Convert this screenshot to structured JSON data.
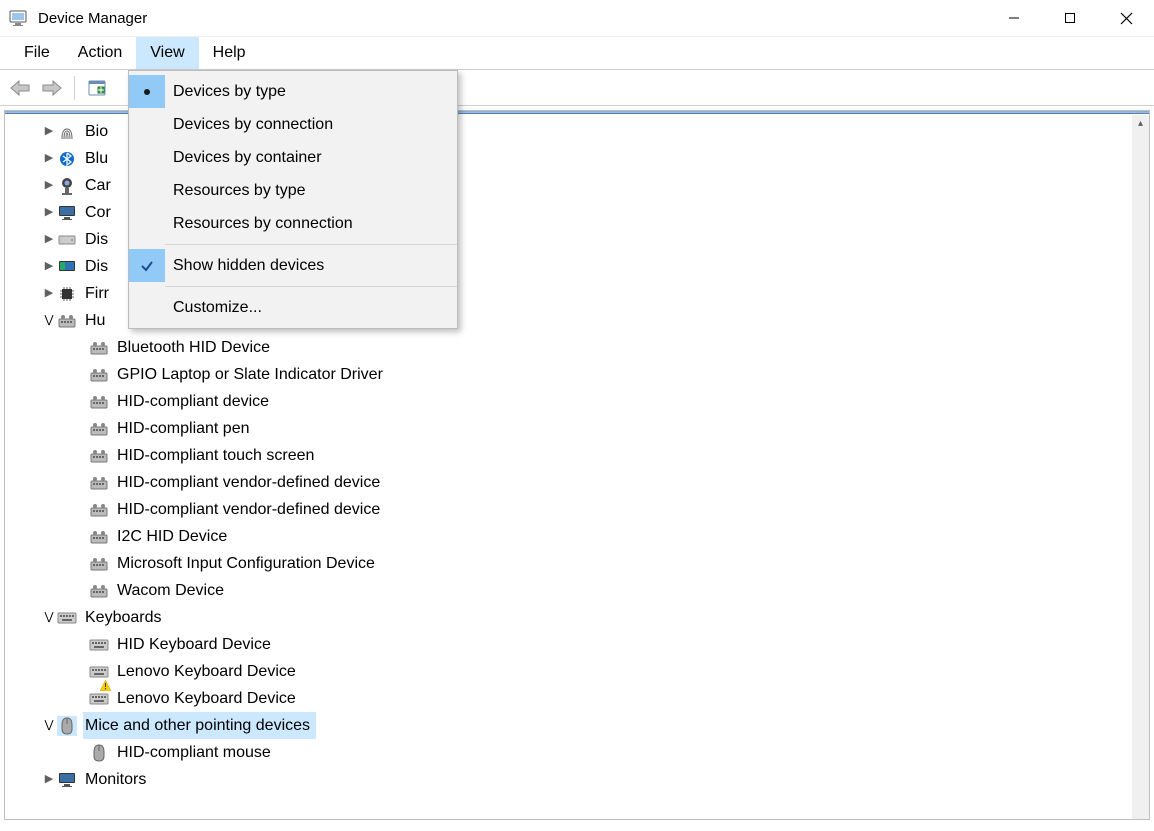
{
  "window": {
    "title": "Device Manager"
  },
  "menu": {
    "file": "File",
    "action": "Action",
    "view": "View",
    "help": "Help"
  },
  "view_menu": {
    "devices_by_type": "Devices by type",
    "devices_by_connection": "Devices by connection",
    "devices_by_container": "Devices by container",
    "resources_by_type": "Resources by type",
    "resources_by_connection": "Resources by connection",
    "show_hidden": "Show hidden devices",
    "customize": "Customize..."
  },
  "tree": {
    "bio": "Bio",
    "blu": "Blu",
    "car": "Car",
    "cor": "Cor",
    "dis1": "Dis",
    "dis2": "Dis",
    "firr": "Firr",
    "hid_category": "Hu",
    "hid": {
      "bluetooth_hid": "Bluetooth HID Device",
      "gpio": "GPIO Laptop or Slate Indicator Driver",
      "hid_device": "HID-compliant device",
      "hid_pen": "HID-compliant pen",
      "hid_touch": "HID-compliant touch screen",
      "hid_vendor1": "HID-compliant vendor-defined device",
      "hid_vendor2": "HID-compliant vendor-defined device",
      "i2c": "I2C HID Device",
      "ms_input": "Microsoft Input Configuration Device",
      "wacom": "Wacom Device"
    },
    "keyboards_category": "Keyboards",
    "keyboards": {
      "hid_kb": "HID Keyboard Device",
      "lenovo1": "Lenovo Keyboard Device",
      "lenovo2": "Lenovo Keyboard Device"
    },
    "mice_category": "Mice and other pointing devices",
    "mice": {
      "hid_mouse": "HID-compliant mouse"
    },
    "monitors": "Monitors"
  }
}
